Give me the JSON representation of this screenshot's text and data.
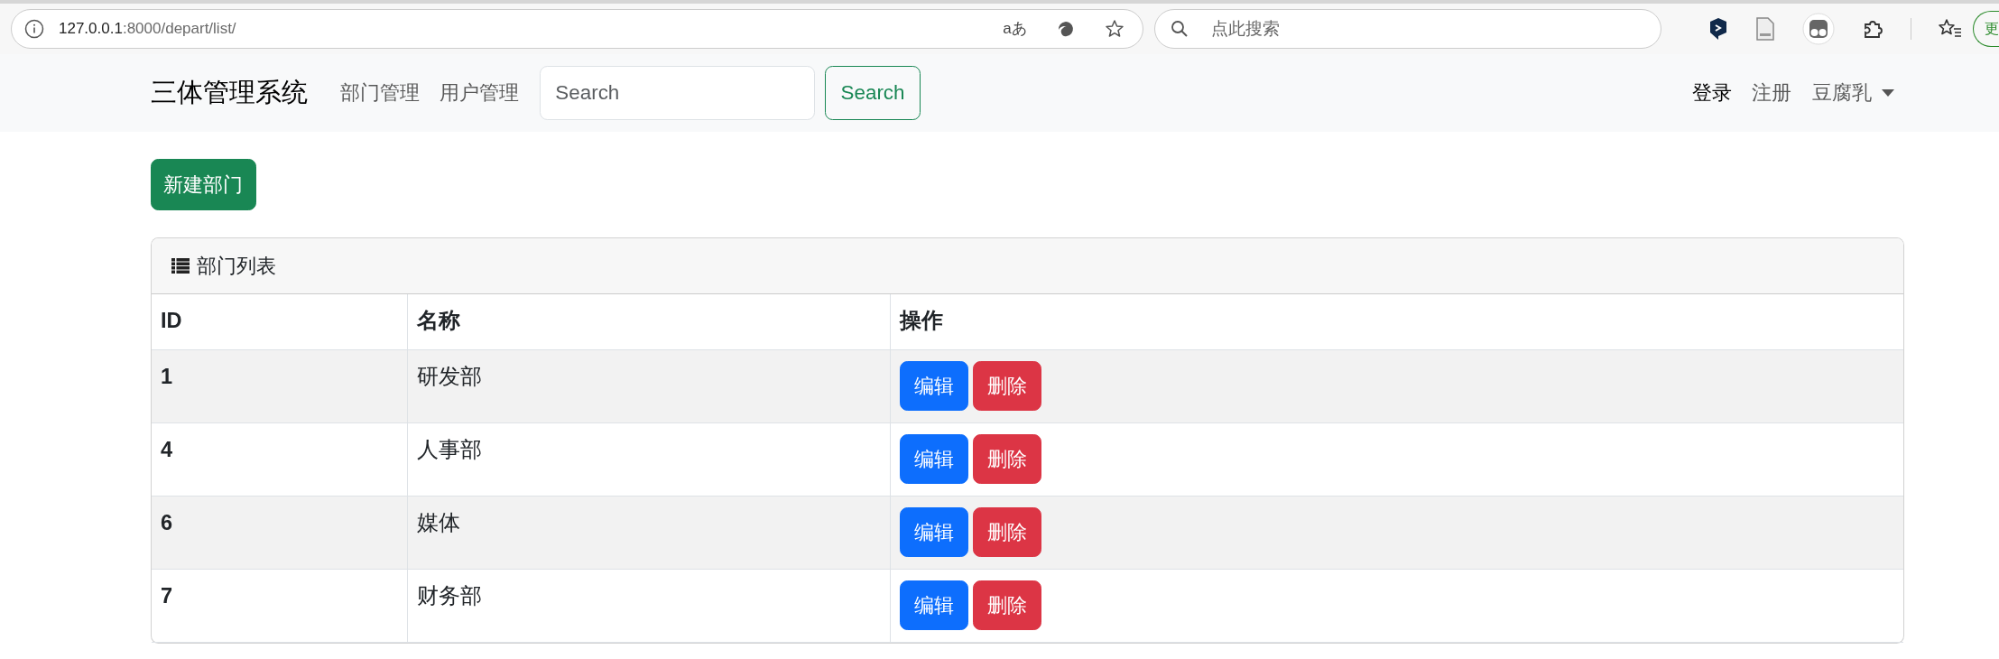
{
  "browser": {
    "address_host": "127.0.0.1",
    "address_rest": ":8000/depart/list/",
    "translate_label": "aあ",
    "search_placeholder": "点此搜索",
    "update_label": "更"
  },
  "navbar": {
    "brand": "三体管理系统",
    "links": [
      {
        "label": "部门管理"
      },
      {
        "label": "用户管理"
      }
    ],
    "search": {
      "placeholder": "Search"
    },
    "search_button": "Search",
    "right_links": [
      {
        "label": "登录",
        "active": true
      },
      {
        "label": "注册",
        "active": false
      }
    ],
    "user_menu": {
      "label": "豆腐乳"
    }
  },
  "new_button": "新建部门",
  "card": {
    "title": "部门列表",
    "table": {
      "columns": [
        "ID",
        "名称",
        "操作"
      ],
      "rows": [
        {
          "id": "1",
          "name": "研发部",
          "actions": [
            {
              "label": "编辑",
              "kind": "edit"
            },
            {
              "label": "删除",
              "kind": "delete"
            }
          ]
        },
        {
          "id": "4",
          "name": "人事部",
          "actions": [
            {
              "label": "编辑",
              "kind": "edit"
            },
            {
              "label": "删除",
              "kind": "delete"
            }
          ]
        },
        {
          "id": "6",
          "name": "媒体",
          "actions": [
            {
              "label": "编辑",
              "kind": "edit"
            },
            {
              "label": "删除",
              "kind": "delete"
            }
          ]
        },
        {
          "id": "7",
          "name": "财务部",
          "actions": [
            {
              "label": "编辑",
              "kind": "edit"
            },
            {
              "label": "删除",
              "kind": "delete"
            }
          ]
        }
      ]
    }
  }
}
